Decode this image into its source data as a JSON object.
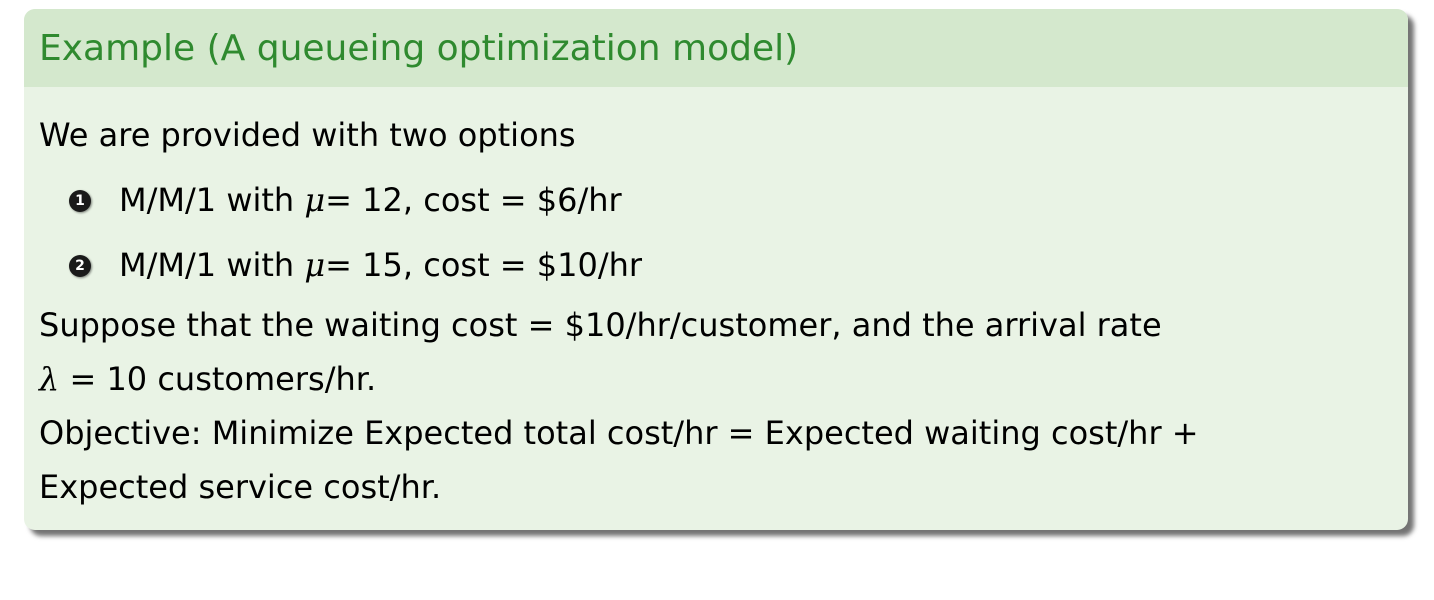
{
  "block": {
    "title": "Example (A queueing optimization model)",
    "intro": "We are provided with two options",
    "options": [
      {
        "number": "1",
        "model": "M/M/1 with",
        "mu_symbol": "μ",
        "rest": " = 12, cost = $6/hr"
      },
      {
        "number": "2",
        "model": "M/M/1 with",
        "mu_symbol": "μ",
        "rest": " = 15, cost = $10/hr"
      }
    ],
    "suppose_line1": "Suppose that the waiting cost = $10/hr/customer, and the arrival rate",
    "lambda_symbol": "λ",
    "suppose_line2": " = 10 customers/hr.",
    "objective_line1": "Objective: Minimize Expected total cost/hr = Expected waiting cost/hr +",
    "objective_line2": "Expected service cost/hr."
  },
  "colors": {
    "title_text": "#2f8a2f",
    "title_bg": "#d4e8cd",
    "body_bg": "#e9f3e5"
  }
}
